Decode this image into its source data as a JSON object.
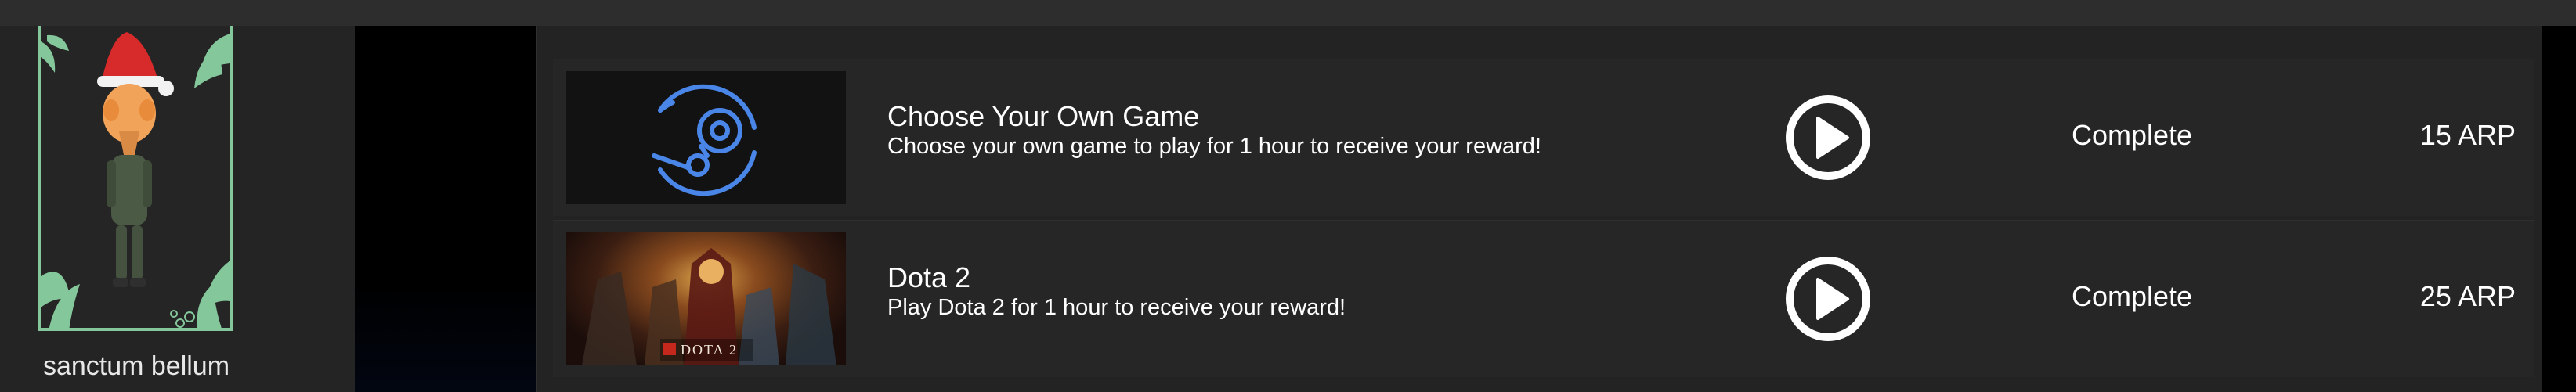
{
  "profile": {
    "username": "sanctum bellum",
    "frame_color": "#84c79b"
  },
  "quests": [
    {
      "title": "Choose Your Own Game",
      "description": "Choose your own game to play for 1 hour to receive your reward!",
      "thumbnail_icon": "steam-logo-icon",
      "status": "Complete",
      "reward": "15 ARP"
    },
    {
      "title": "Dota 2",
      "description": "Play Dota 2 for 1 hour to receive your reward!",
      "thumbnail_icon": "dota2-cover-art",
      "thumbnail_caption": "DOTA 2",
      "status": "Complete",
      "reward": "25 ARP"
    }
  ],
  "colors": {
    "background": "#1f1f1f",
    "row_background": "#262626",
    "steam_blue": "#4a86e8",
    "dota_red": "#c4281c"
  }
}
